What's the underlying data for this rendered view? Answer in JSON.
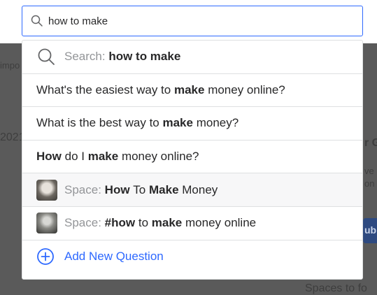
{
  "search": {
    "value": "how to make",
    "icon": "search-icon"
  },
  "background": {
    "frag1": "impo",
    "frag2": "2021",
    "frag3": "r G",
    "frag4a": "ve E",
    "frag4b": "on",
    "frag5": "Spaces to fo",
    "button_fragment": "ubr"
  },
  "suggestions": {
    "search_row": {
      "prefix": "Search: ",
      "query": "how to make"
    },
    "questions": [
      {
        "parts": [
          "What's the easiest way to ",
          "make",
          " money online?"
        ]
      },
      {
        "parts": [
          "What is the best way to ",
          "make",
          " money?"
        ]
      },
      {
        "parts": [
          "How",
          " do I ",
          "make",
          " money online?"
        ]
      }
    ],
    "spaces": [
      {
        "prefix": "Space: ",
        "parts": [
          "How",
          " To ",
          "Make",
          " Money"
        ]
      },
      {
        "prefix": "Space: ",
        "parts": [
          "#how",
          " to ",
          "make",
          " money online"
        ]
      }
    ],
    "add_question": "Add New Question"
  },
  "colors": {
    "accent": "#2e69ff",
    "overlay": "#5a5a5a",
    "text": "#282829",
    "muted": "#939598"
  }
}
